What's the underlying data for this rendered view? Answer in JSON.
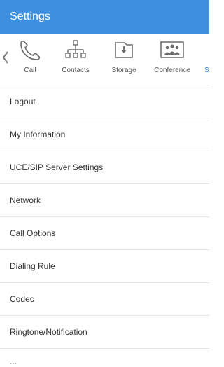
{
  "header": {
    "title": "Settings"
  },
  "tabs": [
    {
      "label": "Call",
      "icon": "phone-icon"
    },
    {
      "label": "Contacts",
      "icon": "org-chart-icon"
    },
    {
      "label": "Storage",
      "icon": "download-folder-icon"
    },
    {
      "label": "Conference",
      "icon": "group-icon"
    },
    {
      "label": "S",
      "icon": ""
    }
  ],
  "menu": {
    "items": [
      "Logout",
      "My Information",
      "UCE/SIP Server Settings",
      "Network",
      "Call Options",
      "Dialing Rule",
      "Codec",
      "Ringtone/Notification",
      "..."
    ]
  },
  "colors": {
    "appbar": "#3f8fe0",
    "icon": "#6a6a6a"
  }
}
